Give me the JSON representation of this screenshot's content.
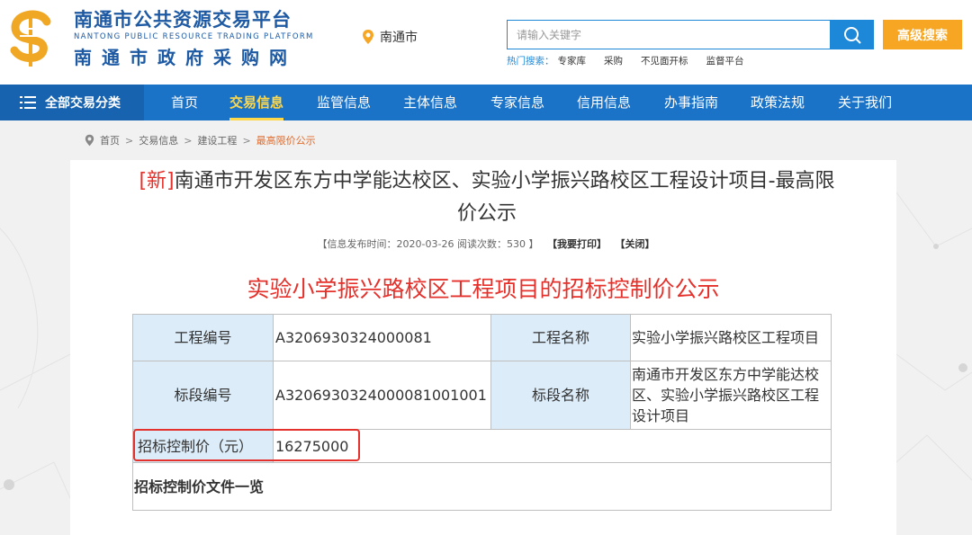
{
  "header": {
    "site_title_cn": "南通市公共资源交易平台",
    "site_title_en": "NANTONG PUBLIC RESOURCE TRADING PLATFORM",
    "site_subtitle_cn": "南通市政府采购网",
    "location": "南通市",
    "search_placeholder": "请输入关键字",
    "advanced_search_label": "高级搜索",
    "hot_label": "热门搜索：",
    "hot_items": [
      "专家库",
      "采购",
      "不见面开标",
      "监督平台"
    ]
  },
  "nav": {
    "all_label": "全部交易分类",
    "items": [
      "首页",
      "交易信息",
      "监管信息",
      "主体信息",
      "专家信息",
      "信用信息",
      "办事指南",
      "政策法规",
      "关于我们"
    ],
    "active_index": 1
  },
  "breadcrumb": {
    "items": [
      "首页",
      "交易信息",
      "建设工程"
    ],
    "current": "最高限价公示",
    "separator": ">"
  },
  "article": {
    "new_tag": "[新]",
    "title_line1": "南通市开发区东方中学能达校区、实验小学振兴路校区工程设计项目-最高限",
    "title_line2": "价公示",
    "meta_info": "【信息发布时间：2020-03-26 阅读次数：530 】",
    "print_label": "【我要打印】",
    "close_label": "【关闭】",
    "subtitle": "实验小学振兴路校区工程项目的招标控制价公示"
  },
  "table": {
    "project_no_label": "工程编号",
    "project_no": "A3206930324000081",
    "project_name_label": "工程名称",
    "project_name": "实验小学振兴路校区工程项目",
    "section_no_label": "标段编号",
    "section_no": "A3206930324000081001001",
    "section_name_label": "标段名称",
    "section_name": "南通市开发区东方中学能达校区、实验小学振兴路校区工程设计项目",
    "price_label": "招标控制价（元）",
    "price": "16275000",
    "docs_label": "招标控制价文件一览"
  },
  "colors": {
    "brand_blue": "#1d5aa3",
    "nav_blue": "#1b73c8",
    "accent_red": "#e5312b",
    "accent_orange": "#f6a623",
    "table_label_bg": "#dcecf9"
  }
}
